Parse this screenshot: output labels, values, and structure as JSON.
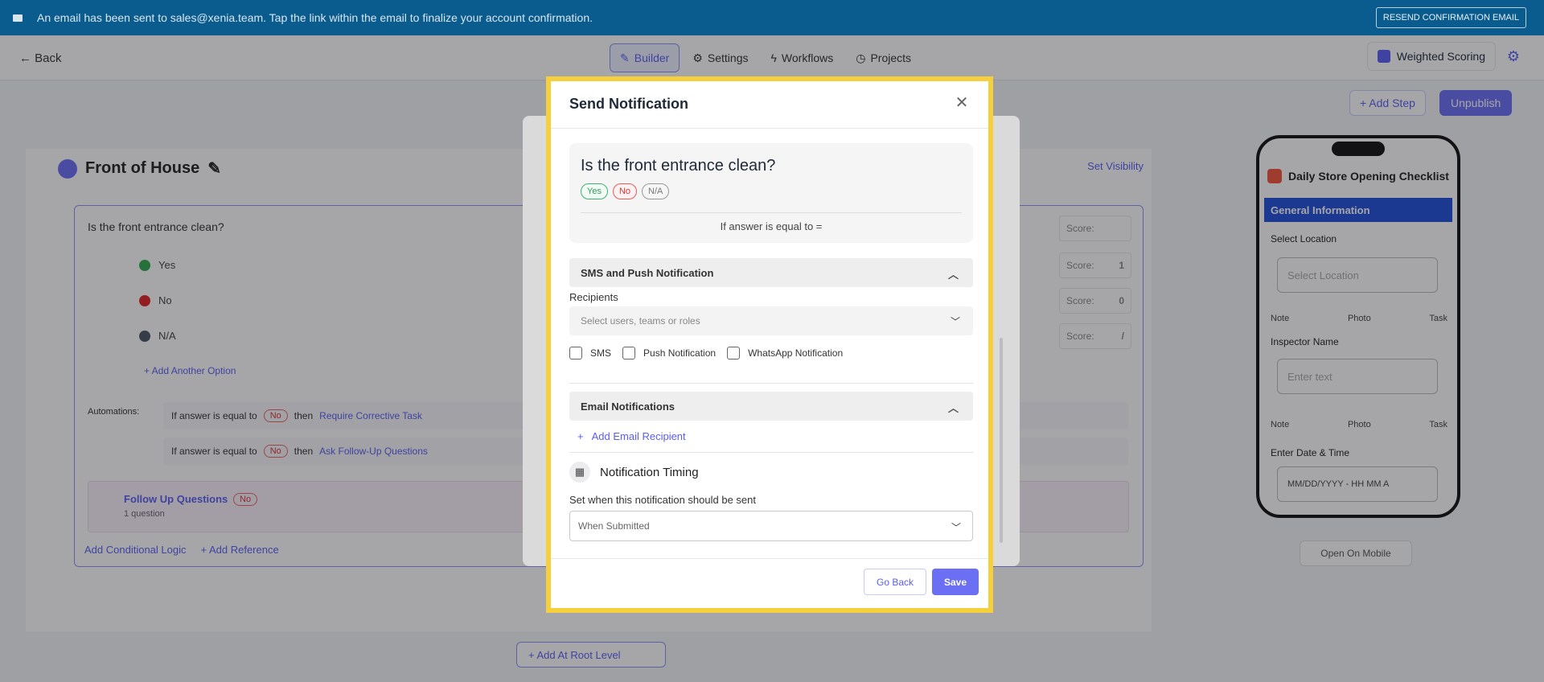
{
  "banner": {
    "message": "An email has been sent to sales@xenia.team. Tap the link within the email to finalize your account confirmation.",
    "resend_label": "RESEND CONFIRMATION EMAIL"
  },
  "topbar": {
    "back_label": "Back",
    "tabs": [
      {
        "label": "Builder",
        "active": true
      },
      {
        "label": "Settings",
        "active": false
      },
      {
        "label": "Workflows",
        "active": false
      },
      {
        "label": "Projects",
        "active": false
      }
    ],
    "weighted_scoring_label": "Weighted Scoring",
    "add_step_label": "+ Add Step",
    "unpublish_label": "Unpublish"
  },
  "builder": {
    "section_title": "Front of House",
    "set_visibility_label": "Set Visibility",
    "question": "Is the front entrance clean?",
    "options": [
      {
        "label": "Yes",
        "color": "#2eaa4f",
        "score": "1"
      },
      {
        "label": "No",
        "color": "#e02424",
        "score": "0"
      },
      {
        "label": "N/A",
        "color": "#4b5563",
        "score": "/"
      }
    ],
    "score_placeholder": "Score:",
    "add_option_label": "+ Add Another Option",
    "automations_label": "Automations:",
    "automations": [
      {
        "prefix": "If answer is equal to",
        "value": "No",
        "then": "then",
        "action": "Require Corrective Task"
      },
      {
        "prefix": "If answer is equal to",
        "value": "No",
        "then": "then",
        "action": "Ask Follow-Up Questions"
      }
    ],
    "follow_up": {
      "title": "Follow Up Questions",
      "badge": "No",
      "count": "1 question"
    },
    "add_conditional_logic": "Add Conditional Logic",
    "add_reference": "+ Add Reference",
    "add_root_label": "+ Add At Root Level"
  },
  "phone": {
    "title": "Daily Store Opening Checklist",
    "section": "General Information",
    "location_label": "Select Location",
    "location_placeholder": "Select Location",
    "inspector_label": "Inspector Name",
    "inspector_placeholder": "Enter text",
    "datetime_label": "Enter Date & Time",
    "datetime_placeholder": "MM/DD/YYYY - HH MM A",
    "note_label": "Note",
    "photo_label": "Photo",
    "task_label": "Task",
    "open_on_mobile_label": "Open On Mobile"
  },
  "modal": {
    "title": "Send Notification",
    "question": "Is the front entrance clean?",
    "chips": {
      "yes": "Yes",
      "no": "No",
      "na": "N/A"
    },
    "condition": "If answer is equal to =",
    "sms_section": "SMS and Push Notification",
    "recipients_label": "Recipients",
    "recipients_placeholder": "Select users, teams or roles",
    "channels": {
      "sms": "SMS",
      "push": "Push Notification",
      "whatsapp": "WhatsApp Notification"
    },
    "email_section": "Email Notifications",
    "add_email_label": "Add Email Recipient",
    "timing_title": "Notification Timing",
    "timing_help": "Set when this notification should be sent",
    "timing_value": "When Submitted",
    "go_back_label": "Go Back",
    "save_label": "Save"
  }
}
